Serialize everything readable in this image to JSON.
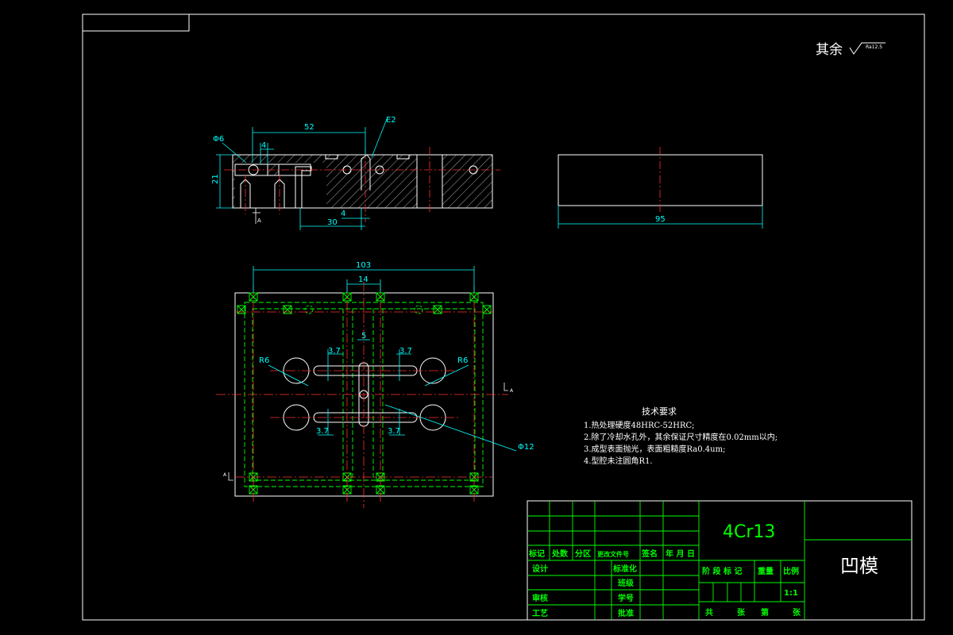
{
  "top_note": {
    "label": "其余",
    "roughness": "Ra12.5"
  },
  "section_view": {
    "dims": {
      "d52": "52",
      "d4_top": "4",
      "d4_bottom": "4",
      "d30": "30",
      "d21": "21",
      "phi6": "Φ6",
      "e2": "E2"
    },
    "labels": {
      "a": "A"
    }
  },
  "side_view": {
    "dims": {
      "d95": "95"
    }
  },
  "plan_view": {
    "dims": {
      "d103": "103",
      "d14": "14",
      "d5": "5",
      "d37_tl": "3.7",
      "d37_tr": "3.7",
      "d37_bl": "3.7",
      "d37_br": "3.7",
      "r6_left": "R6",
      "r6_right": "R6",
      "phi12": "Φ12"
    },
    "labels": {
      "a_right": "A",
      "a_left": "A"
    }
  },
  "tech_requirements": {
    "title": "技术要求",
    "items": [
      "1.热处理硬度48HRC-52HRC;",
      "2.除了冷却水孔外，其余保证尺寸精度在0.02mm以内;",
      "3.成型表面抛光，表面粗糙度Ra0.4um;",
      "4.型腔未注圆角R1."
    ]
  },
  "title_block": {
    "material": "4Cr13",
    "part_name": "凹模",
    "headers": [
      "标记",
      "处数",
      "分区",
      "更改文件号",
      "签名",
      "年 月 日"
    ],
    "left_rows": [
      "设计",
      "审核",
      "工艺"
    ],
    "mid_rows": [
      "标准化",
      "班级",
      "学号",
      "批准"
    ],
    "stage_label": "阶 段 标 记",
    "weight_label": "重量",
    "scale_label": "比例",
    "scale_value": "1:1",
    "sheet_total": "共",
    "sheet_unit1": "张",
    "sheet_of": "第",
    "sheet_unit2": "张"
  },
  "colors": {
    "frame": "#ffffff",
    "dim": "#00ffff",
    "center": "#ff3030",
    "green": "#00ff00",
    "hatch": "#ffffff",
    "titleblock": "#00ff00"
  }
}
